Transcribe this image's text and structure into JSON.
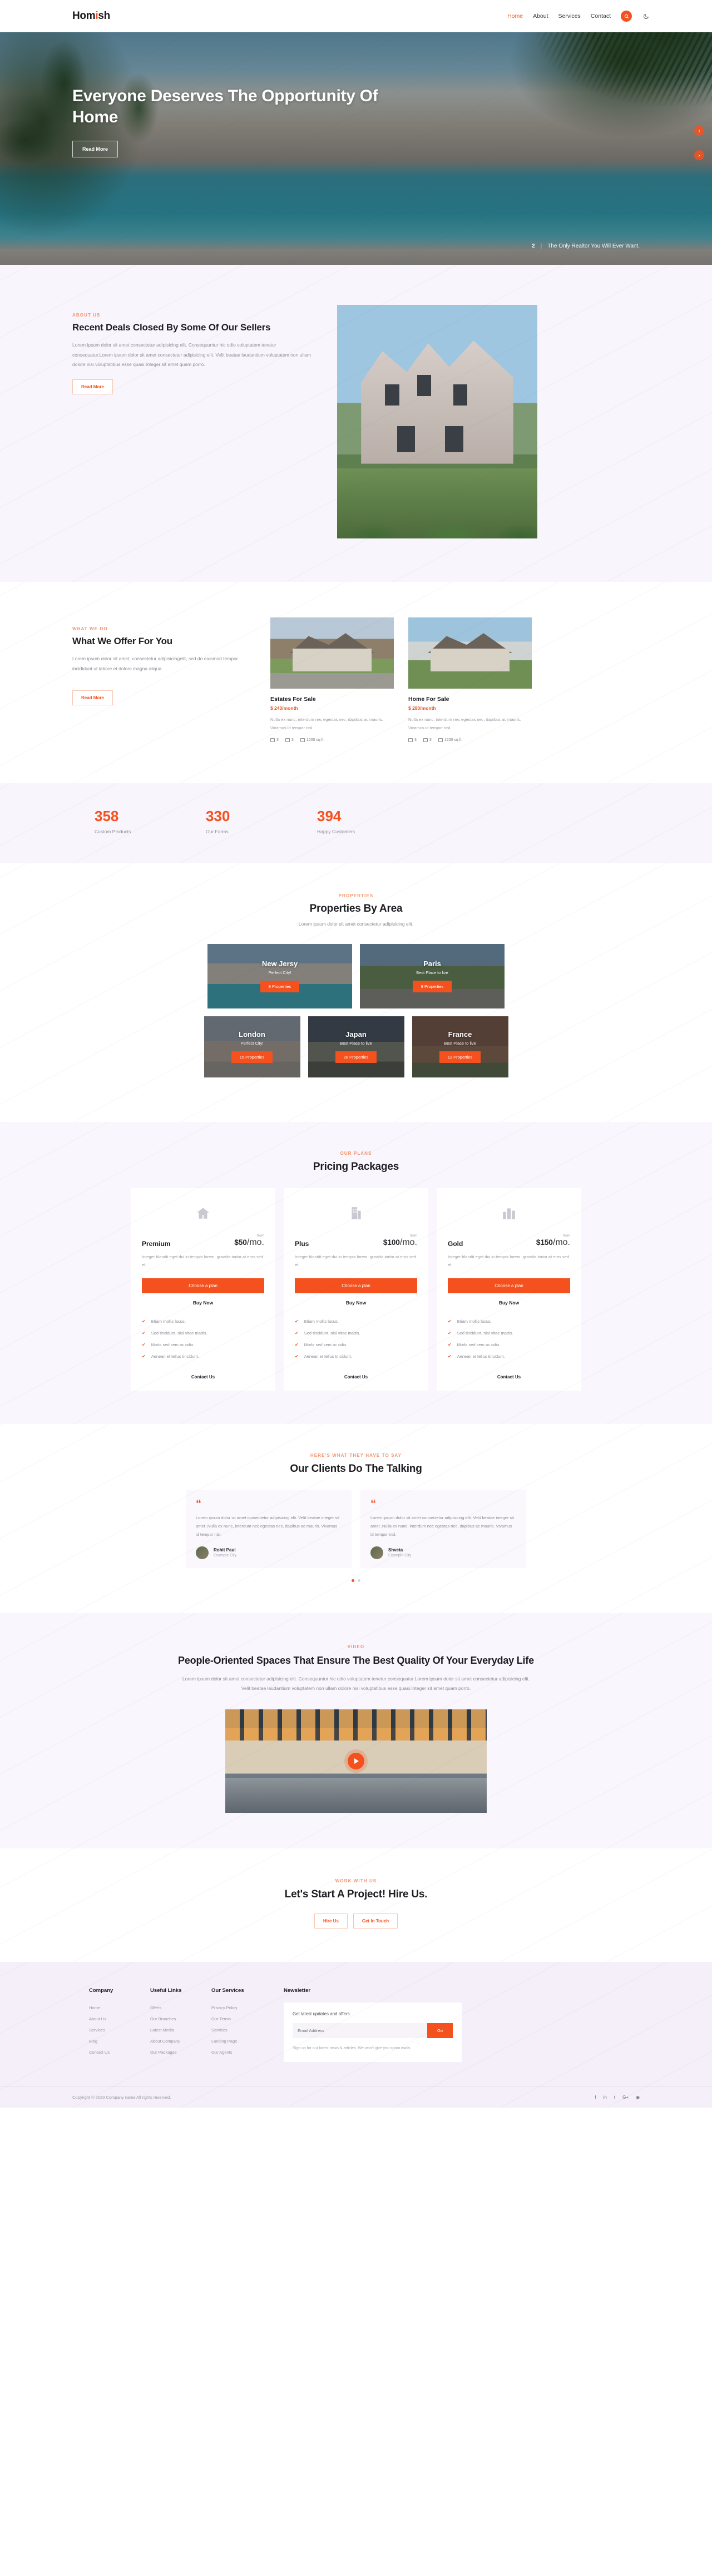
{
  "header": {
    "logo_first": "Hom",
    "logo_accent": "i",
    "logo_last": "sh",
    "nav": [
      {
        "label": "Home",
        "active": true
      },
      {
        "label": "About",
        "active": false
      },
      {
        "label": "Services",
        "active": false
      },
      {
        "label": "Contact",
        "active": false
      }
    ],
    "search_icon": "search-icon",
    "theme_icon": "moon-icon"
  },
  "hero": {
    "title": "Everyone Deserves The Opportunity Of Home",
    "button": "Read More",
    "slide_number": "2",
    "slide_caption": "The Only Realtor You Will Ever Want.",
    "arrow_up": "‹",
    "arrow_down": "›"
  },
  "about": {
    "eyebrow": "ABOUT US",
    "title": "Recent Deals Closed By Some Of Our Sellers",
    "body": "Lorem ipsum dolor sit amet consectetur adipisicing elit. Consequuntur hic odio voluptatem tenetur consequatur.Lorem ipsum dolor sit amet consectetur adipisicing elit. Velit beatae laudantium voluptatem non ullam dolore nisi voluptatibus esse quasi.Integer sit amet quam porro.",
    "button": "Read More"
  },
  "offer": {
    "eyebrow": "WHAT WE DO",
    "title": "What We Offer For You",
    "body": "Lorem ipsum dolor sit amet, consectetur adipisicingelit, sed do eiusmod tempor incididunt ut labore et dolore magna aliqua.",
    "button": "Read More",
    "cards": [
      {
        "title": "Estates For Sale",
        "price": "$ 240/month",
        "desc": "Nulla ex nunc, interdum nec egestas nec, dapibus ac mauris. Vivamus id tempor nisl.",
        "beds": "3",
        "baths": "3",
        "area": "1200 sq ft"
      },
      {
        "title": "Home For Sale",
        "price": "$ 280/month",
        "desc": "Nulla ex nunc, interdum nec egestas nec, dapibus ac mauris. Vivamus id tempor nisl.",
        "beds": "3",
        "baths": "3",
        "area": "1200 sq ft"
      }
    ]
  },
  "counters": [
    {
      "number": "358",
      "label": "Custom Products"
    },
    {
      "number": "330",
      "label": "Our Farms"
    },
    {
      "number": "394",
      "label": "Happy Customers"
    }
  ],
  "areas": {
    "eyebrow": "PROPERTIES",
    "title": "Properties By Area",
    "subtitle": "Lorem ipsum dolor sit amet consectetur adipisicing elit.",
    "row1": [
      {
        "name": "New Jersy",
        "tag": "Perfect City!",
        "count": "8 Properties"
      },
      {
        "name": "Paris",
        "tag": "Best Place to live",
        "count": "8 Properties"
      }
    ],
    "row2": [
      {
        "name": "London",
        "tag": "Perfect City!",
        "count": "15 Properties"
      },
      {
        "name": "Japan",
        "tag": "Best Place to live",
        "count": "28 Properties"
      },
      {
        "name": "France",
        "tag": "Best Place to live",
        "count": "12 Properties"
      }
    ]
  },
  "pricing": {
    "eyebrow": "OUR PLANS",
    "title": "Pricing Packages",
    "from_label": "from",
    "per_label": "/mo.",
    "cta": "Choose a plan",
    "buy": "Buy Now",
    "contact": "Contact Us",
    "plans": [
      {
        "name": "Premium",
        "price": "$50",
        "icon": "house-icon",
        "desc": "Integer blandit eget dui in tempor lorem. gravida tortor at eros sed et."
      },
      {
        "name": "Plus",
        "price": "$100",
        "icon": "building-icon",
        "desc": "Integer blandit eget dui in tempor lorem. gravida tortor at eros sed et."
      },
      {
        "name": "Gold",
        "price": "$150",
        "icon": "city-icon",
        "desc": "Integer blandit eget dui in tempor lorem. gravida tortor at eros sed et."
      }
    ],
    "features": [
      "Etiam mollis lacus.",
      "Sed tincidunt, nisl vitae mattis.",
      "Morbi sed sem ac odio.",
      "Aenean et tellus tincidunt."
    ]
  },
  "testimonials": {
    "eyebrow": "HERE'S WHAT THEY HAVE TO SAY",
    "title": "Our Clients Do The Talking",
    "items": [
      {
        "quote": "Lorem ipsum dolor sit amet consectetur adipisicing elit. Velit beatae integer sit amet .Nulla ex nunc, interdum nec egestas nec, dapibus ac mauris. Vivamus id tempor nisl.",
        "name": "Rohit Paul",
        "city": "Example City"
      },
      {
        "quote": "Lorem ipsum dolor sit amet consectetur adipisicing elit. Velit beatae integer sit amet .Nulla ex nunc, interdum nec egestas nec, dapibus ac mauris. Vivamus id tempor nisl.",
        "name": "Shveta",
        "city": "Example City"
      }
    ]
  },
  "video": {
    "eyebrow": "VIDEO",
    "title": "People-Oriented Spaces That Ensure The Best Quality Of Your Everyday Life",
    "body": "Lorem ipsum dolor sit amet consectetur adipisicing elit. Consequuntur hic odio voluptatem tenetur consequatur.Lorem ipsum dolor sit amet consectetur adipisicing elit. Velit beatae laudantium voluptatem non ullam dolore nisi voluptatibus esse quasi.Integer sit amet quam porro.",
    "play_icon": "play-icon"
  },
  "cta": {
    "eyebrow": "WORK WITH US",
    "title": "Let's Start A Project! Hire Us.",
    "primary": "Hire Us",
    "secondary": "Get In Touch"
  },
  "footer": {
    "columns": [
      {
        "title": "Company",
        "links": [
          "Home",
          "About Us",
          "Services",
          "Blog",
          "Contact Us"
        ]
      },
      {
        "title": "Useful Links",
        "links": [
          "Offers",
          "Our Branches",
          "Latest Media",
          "About Company",
          "Our Packages"
        ]
      },
      {
        "title": "Our Services",
        "links": [
          "Privacy Policy",
          "Our Terms",
          "Services",
          "Landing Page",
          "Our Agents"
        ]
      }
    ],
    "newsletter": {
      "title": "Newsletter",
      "lead": "Get latest updates and offers.",
      "placeholder": "Email Address",
      "button": "Go",
      "note": "Sign up for our latest news & articles. We won't give you spam mails."
    },
    "copyright": "Copyright © 2020 Company name All rights reserved.",
    "socials": [
      "facebook-icon",
      "linkedin-icon",
      "twitter-icon",
      "google-plus-icon",
      "instagram-icon"
    ]
  },
  "colors": {
    "accent": "#f4511e",
    "lavender": "#f9f5fc",
    "dark": "#1d1d22"
  }
}
